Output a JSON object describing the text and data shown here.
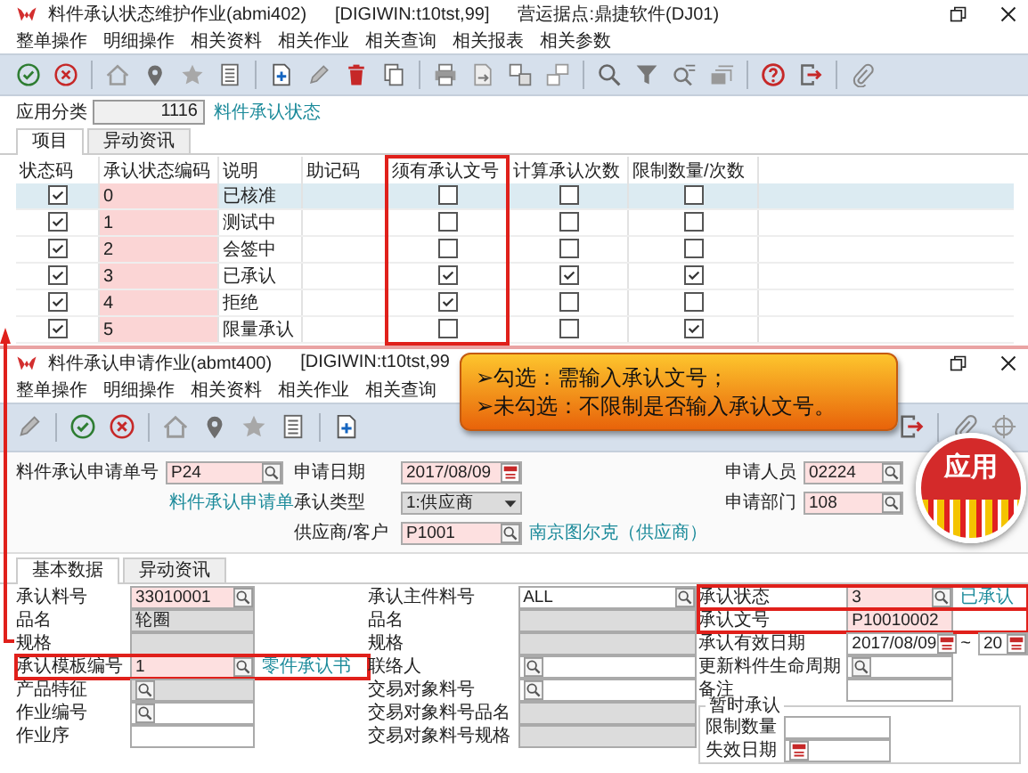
{
  "window1": {
    "title": "料件承认状态维护作业(abmi402)",
    "context": "[DIGIWIN:t10tst,99]",
    "company": "营运据点:鼎捷软件(DJ01)",
    "menu": [
      "整单操作",
      "明细操作",
      "相关资料",
      "相关作业",
      "相关查询",
      "相关报表",
      "相关参数"
    ],
    "category": {
      "label": "应用分类",
      "value": "1116",
      "link": "料件承认状态"
    },
    "tabs": [
      {
        "label": "项目",
        "selected": true
      },
      {
        "label": "异动资讯",
        "selected": false
      }
    ],
    "table": {
      "columns": [
        {
          "label": "状态码",
          "highlighted": false
        },
        {
          "label": "承认状态编码",
          "highlighted": false
        },
        {
          "label": "说明",
          "highlighted": false
        },
        {
          "label": "助记码",
          "highlighted": false
        },
        {
          "label": "须有承认文号",
          "highlighted": true
        },
        {
          "label": "计算承认次数",
          "highlighted": false
        },
        {
          "label": "限制数量/次数",
          "highlighted": false
        }
      ],
      "rows": [
        {
          "selected": true,
          "enabled": true,
          "code": "0",
          "description": "已核准",
          "checks": [
            false,
            false,
            false
          ]
        },
        {
          "selected": false,
          "enabled": true,
          "code": "1",
          "description": "测试中",
          "checks": [
            false,
            false,
            false
          ]
        },
        {
          "selected": false,
          "enabled": true,
          "code": "2",
          "description": "会签中",
          "checks": [
            false,
            false,
            false
          ]
        },
        {
          "selected": false,
          "enabled": true,
          "code": "3",
          "description": "已承认",
          "checks": [
            true,
            true,
            true
          ]
        },
        {
          "selected": false,
          "enabled": true,
          "code": "4",
          "description": "拒绝",
          "checks": [
            true,
            false,
            false
          ]
        },
        {
          "selected": false,
          "enabled": true,
          "code": "5",
          "description": "限量承认",
          "checks": [
            false,
            false,
            true
          ]
        }
      ]
    }
  },
  "window2": {
    "title": "料件承认申请作业(abmt400)",
    "context": "[DIGIWIN:t10tst,99",
    "menu": [
      "整单操作",
      "明细操作",
      "相关资料",
      "相关作业",
      "相关查询"
    ],
    "header": {
      "columns": [
        [
          {
            "kind": "lookup",
            "label": "料件承认申请单号",
            "value": "P24",
            "required": true,
            "disabled": false,
            "highlighted": false
          },
          {
            "kind": "link",
            "text": "料件承认申请单"
          }
        ],
        [
          {
            "kind": "date",
            "label": "申请日期",
            "value": "2017/08/09",
            "required": true,
            "disabled": false,
            "highlighted": false
          },
          {
            "kind": "select",
            "label": "承认类型",
            "value": "1:供应商",
            "required": false,
            "disabled": true,
            "highlighted": false
          },
          {
            "kind": "lookup",
            "label": "供应商/客户",
            "value": "P1001",
            "required": true,
            "disabled": false,
            "highlighted": false,
            "link": "南京图尔克（供应商）"
          }
        ],
        [
          {
            "kind": "lookup",
            "label": "申请人员",
            "value": "02224",
            "required": true,
            "disabled": false,
            "highlighted": false
          },
          {
            "kind": "lookup",
            "label": "申请部门",
            "value": "108",
            "required": true,
            "disabled": false,
            "highlighted": false
          }
        ]
      ]
    },
    "tabs": [
      {
        "label": "基本数据",
        "selected": true
      },
      {
        "label": "异动资讯",
        "selected": false
      }
    ],
    "body": {
      "columns": [
        [
          {
            "kind": "lookup",
            "label": "承认料号",
            "value": "33010001",
            "required": true,
            "disabled": false,
            "highlighted": false
          },
          {
            "kind": "text",
            "label": "品名",
            "value": "轮圈",
            "required": false,
            "disabled": true,
            "highlighted": false
          },
          {
            "kind": "text",
            "label": "规格",
            "required": false,
            "disabled": true,
            "highlighted": false
          },
          {
            "kind": "lookup",
            "label": "承认模板编号",
            "value": "1",
            "required": true,
            "disabled": false,
            "highlighted": true,
            "link": "零件承认书"
          },
          {
            "kind": "lookup",
            "label": "产品特征",
            "required": false,
            "disabled": true,
            "highlighted": false
          },
          {
            "kind": "lookup",
            "label": "作业编号",
            "required": false,
            "disabled": false,
            "highlighted": false
          },
          {
            "kind": "text",
            "label": "作业序",
            "required": false,
            "disabled": false,
            "highlighted": false
          }
        ],
        [
          {
            "kind": "lookup",
            "label": "承认主件料号",
            "value": "ALL",
            "required": false,
            "disabled": false,
            "highlighted": false
          },
          {
            "kind": "text",
            "label": "品名",
            "required": false,
            "disabled": true,
            "highlighted": false
          },
          {
            "kind": "text",
            "label": "规格",
            "required": false,
            "disabled": true,
            "highlighted": false
          },
          {
            "kind": "lookup",
            "label": "联络人",
            "required": false,
            "disabled": false,
            "highlighted": false
          },
          {
            "kind": "lookup",
            "label": "交易对象料号",
            "required": false,
            "disabled": false,
            "highlighted": false
          },
          {
            "kind": "text",
            "label": "交易对象料号品名",
            "required": false,
            "disabled": true,
            "highlighted": false
          },
          {
            "kind": "text",
            "label": "交易对象料号规格",
            "required": false,
            "disabled": true,
            "highlighted": false
          }
        ],
        [
          {
            "kind": "lookup",
            "label": "承认状态",
            "value": "3",
            "required": true,
            "disabled": false,
            "highlighted": true,
            "link": "已承认"
          },
          {
            "kind": "text",
            "label": "承认文号",
            "value": "P10010002",
            "required": true,
            "disabled": false,
            "highlighted": true
          },
          {
            "kind": "daterange",
            "label": "承认有效日期",
            "value": "2017/08/09",
            "separator": "~",
            "value_to": "20",
            "required": false,
            "disabled": false,
            "highlighted": false
          },
          {
            "kind": "lookup",
            "label": "更新料件生命周期",
            "required": false,
            "disabled": false,
            "highlighted": false
          },
          {
            "kind": "text",
            "label": "备注",
            "required": false,
            "disabled": false,
            "highlighted": false
          },
          {
            "kind": "group",
            "label": "暂时承认",
            "fields": [
              {
                "kind": "text",
                "label": "限制数量",
                "required": false,
                "disabled": false,
                "highlighted": false
              },
              {
                "kind": "date",
                "label": "失效日期",
                "required": false,
                "disabled": false,
                "highlighted": false
              }
            ]
          }
        ]
      ]
    }
  },
  "callout": {
    "lines": [
      "➢勾选：需输入承认文号；",
      "➢未勾选：不限制是否输入承认文号。"
    ]
  },
  "badge": {
    "text": "应用"
  }
}
